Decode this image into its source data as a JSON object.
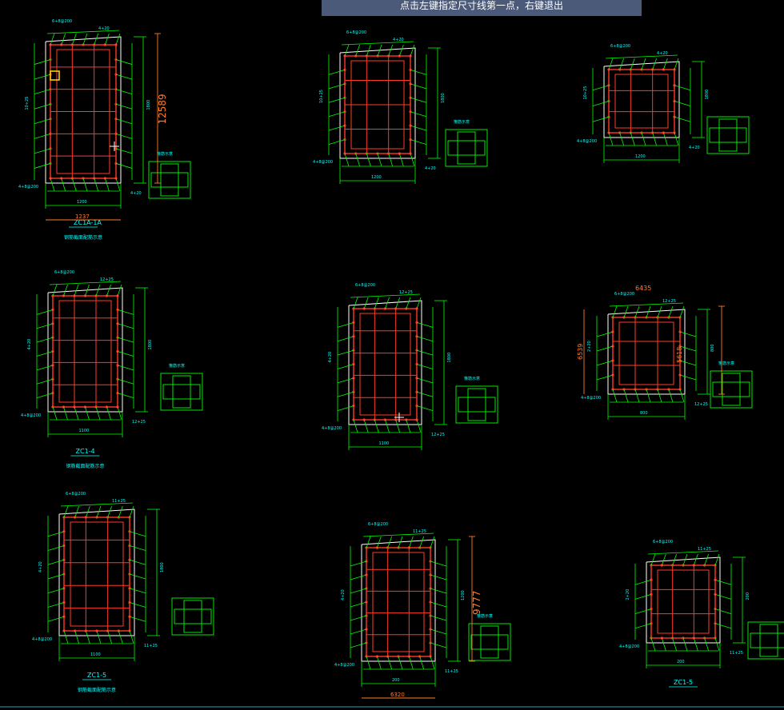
{
  "prompt": "点击左键指定尺寸线第一点，右键退出",
  "colors": {
    "background": "#000000",
    "rebar": "#ff3a2a",
    "dim": "#00ff00",
    "text": "#00ffff",
    "outline": "#ffffff",
    "highlight": "#ff7b2a",
    "pick_box": "#ffcc00",
    "prompt_bg": "#4a5a78"
  },
  "sections": [
    {
      "id": "ZC1A-1A",
      "label": "ZC1A-1A",
      "caption": "钢筋截面配筋示意",
      "top_label": "6+8@200",
      "top_bar": "4+20",
      "left_dim": "10+25",
      "right_dim": "1800",
      "bottom_dim": "1200",
      "bottom_stirrup": "4+8@200",
      "bottom_bar": "4+20",
      "legend": "箍筋示意",
      "highlight_value": "12589",
      "highlight_bottom": "1237"
    },
    {
      "id": "sec-2",
      "label": "",
      "caption": "",
      "top_label": "6+8@200",
      "top_bar": "4+20",
      "left_dim": "10+25",
      "right_dim": "1800",
      "bottom_dim": "1200",
      "bottom_stirrup": "4+8@200",
      "bottom_bar": "4+20",
      "legend": "箍筋示意"
    },
    {
      "id": "sec-3",
      "label": "",
      "caption": "",
      "top_label": "6+8@200",
      "top_bar": "4+20",
      "left_dim": "10+25",
      "right_dim": "1800",
      "bottom_dim": "1200",
      "bottom_stirrup": "4+8@200",
      "bottom_bar": "4+20",
      "legend": ""
    },
    {
      "id": "ZC1-4",
      "label": "ZC1-4",
      "caption": "钢筋截面配筋示意",
      "top_label": "6+8@200",
      "top_bar": "12+25",
      "left_dim": "4+20",
      "right_dim": "1800",
      "bottom_dim": "1100",
      "bottom_stirrup": "4+8@200",
      "bottom_bar": "12+25",
      "legend": "箍筋示意"
    },
    {
      "id": "sec-5",
      "label": "",
      "caption": "",
      "top_label": "6+8@200",
      "top_bar": "12+25",
      "left_dim": "4+20",
      "right_dim": "1800",
      "bottom_dim": "1100",
      "bottom_stirrup": "4+8@200",
      "bottom_bar": "12+25",
      "legend": "箍筋示意"
    },
    {
      "id": "sec-6",
      "label": "",
      "caption": "",
      "top_label": "6+8@200",
      "top_bar": "12+25",
      "left_dim": "2+20",
      "right_dim": "800",
      "bottom_dim": "800",
      "bottom_stirrup": "4+8@200",
      "bottom_bar": "12+25",
      "legend": "箍筋示意",
      "highlight_value": "6435",
      "highlight_left": "6539",
      "highlight_right": "5618"
    },
    {
      "id": "ZC1-5",
      "label": "ZC1-5",
      "caption": "钢筋截面配筋示意",
      "top_label": "6+8@200",
      "top_bar": "11+25",
      "left_dim": "4+20",
      "right_dim": "1800",
      "bottom_dim": "1100",
      "bottom_stirrup": "4+8@200",
      "bottom_bar": "11+25",
      "legend": ""
    },
    {
      "id": "sec-8",
      "label": "",
      "caption": "",
      "top_label": "6+8@200",
      "top_bar": "11+25",
      "left_dim": "4+20",
      "right_dim": "1200",
      "bottom_dim": "200",
      "bottom_stirrup": "4+8@200",
      "bottom_bar": "11+25",
      "legend": "箍筋示意",
      "highlight_value": "9777",
      "highlight_bottom": "6320"
    },
    {
      "id": "ZC1-5b",
      "label": "ZC1-5",
      "caption": "",
      "top_label": "6+8@200",
      "top_bar": "11+25",
      "left_dim": "2+20",
      "right_dim": "200",
      "bottom_dim": "200",
      "bottom_stirrup": "4+8@200",
      "bottom_bar": "11+25",
      "legend": ""
    }
  ]
}
